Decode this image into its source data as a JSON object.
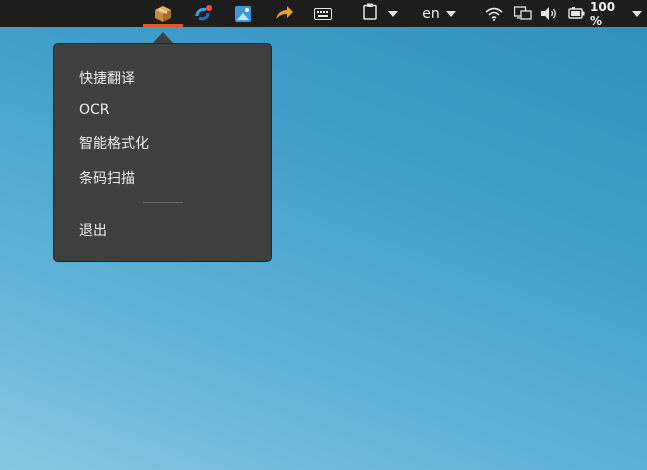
{
  "topbar": {
    "language": "en",
    "battery_percent": "100 %",
    "icons": [
      "package-app-indicator-icon",
      "sync-cloud-indicator-icon",
      "image-editor-indicator-icon",
      "share-arrow-indicator-icon",
      "keyboard-icon",
      "clipboard-icon",
      "wifi-icon",
      "network-icon",
      "volume-icon",
      "battery-icon"
    ]
  },
  "menu": {
    "items": [
      {
        "label": "快捷翻译"
      },
      {
        "label": "OCR"
      },
      {
        "label": "智能格式化"
      },
      {
        "label": "条码扫描"
      },
      {
        "label": "退出"
      }
    ]
  },
  "colors": {
    "topbar_bg": "#1d1d1d",
    "menu_bg": "#3f3f3f",
    "accent": "#e95420",
    "desktop_start": "#2f8fbd",
    "desktop_end": "#86c7e2"
  }
}
